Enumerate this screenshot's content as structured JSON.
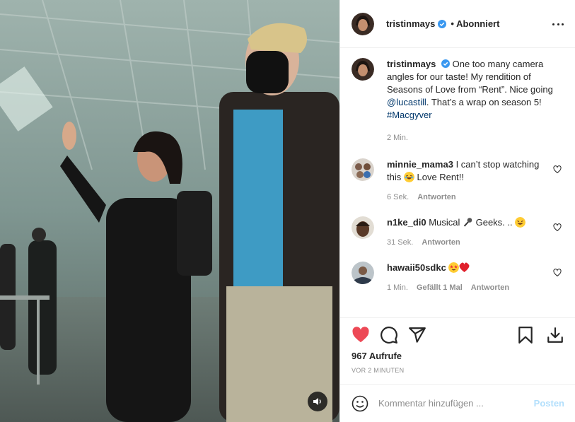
{
  "post": {
    "author": "tristinmays",
    "follow_status": "Abonniert",
    "caption_author": "tristinmays",
    "caption_parts": {
      "a": "One too many camera angles for our taste! My rendition of Seasons of Love from “Rent”. Nice going ",
      "mention": "@lucastill",
      "b": ". That’s a wrap on season 5! ",
      "hashtag": "#Macgyver"
    },
    "caption_time": "2 Min."
  },
  "comments": [
    {
      "user": "minnie_mama3",
      "text_a": "I can’t stop watching this",
      "text_b": "Love Rent!!",
      "emoji": "joy-emoji",
      "time": "6 Sek.",
      "reply": "Antworten"
    },
    {
      "user": "n1ke_di0",
      "text_a": "Musical",
      "text_b": "Geeks. ..",
      "emoji": "microphone-emoji",
      "time": "31 Sek.",
      "reply": "Antworten"
    },
    {
      "user": "hawaii50sdkc",
      "text_a": "",
      "emoji": "star-struck-emoji",
      "time": "1 Min.",
      "likes": "Gefällt 1 Mal",
      "reply": "Antworten"
    }
  ],
  "stats": {
    "views": "967 Aufrufe",
    "posted_ago": "VOR 2 MINUTEN"
  },
  "composer": {
    "placeholder": "Kommentar hinzufügen ...",
    "post_label": "Posten"
  },
  "colors": {
    "liked_heart": "#ed4956",
    "verified": "#3897f0",
    "link": "#00376b",
    "post_disabled": "#b2dffc"
  },
  "icons": [
    "verified-icon",
    "more-options-icon",
    "heart-icon",
    "comment-icon",
    "share-icon",
    "save-icon",
    "download-icon",
    "emoji-icon",
    "sound-icon"
  ]
}
